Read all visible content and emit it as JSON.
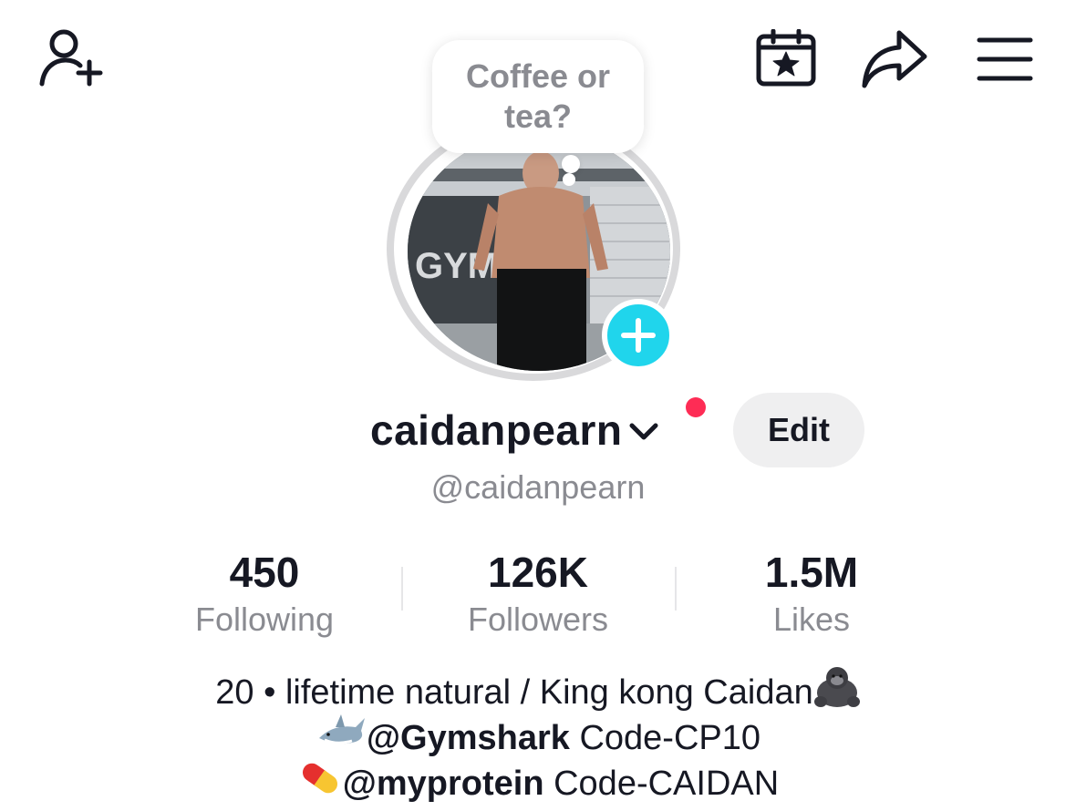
{
  "note": {
    "line1": "Coffee or",
    "line2": "tea?"
  },
  "profile": {
    "username": "caidanpearn",
    "handle": "@caidanpearn",
    "edit_label": "Edit",
    "avatar_text": "GYMS"
  },
  "stats": [
    {
      "value": "450",
      "label": "Following"
    },
    {
      "value": "126K",
      "label": "Followers"
    },
    {
      "value": "1.5M",
      "label": "Likes"
    }
  ],
  "bio": {
    "line1": "20 • lifetime natural / King kong Caidan",
    "line1_emoji": "gorilla",
    "line2_emoji": "shark",
    "line2_mention": "@Gymshark",
    "line2_text": " Code-CP10",
    "line3_emoji": "pill",
    "line3_mention": "@myprotein",
    "line3_text": " Code-CAIDAN"
  },
  "colors": {
    "accent_cyan": "#20d5ec",
    "notification_red": "#fe2c55",
    "text_primary": "#161823",
    "text_secondary": "#8a8b91"
  }
}
